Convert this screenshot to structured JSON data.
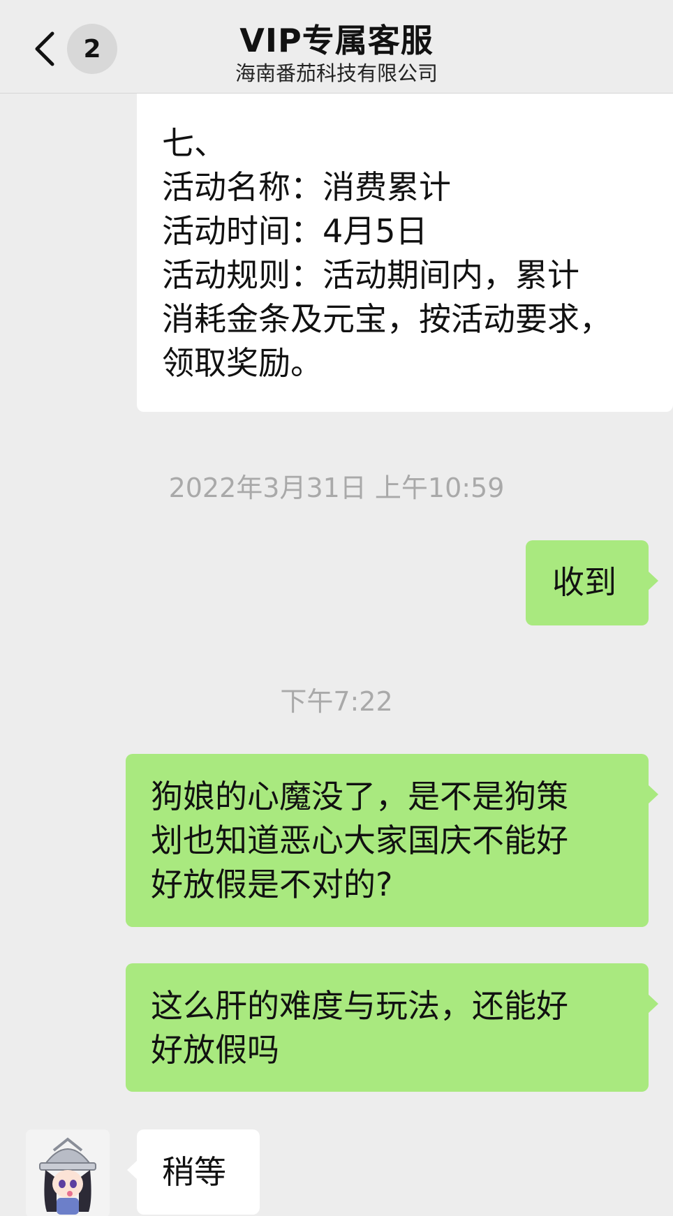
{
  "header": {
    "back_icon": "chevron-left-icon",
    "unread_count": "2",
    "title": "VIP专属客服",
    "subtitle": "海南番茄科技有限公司"
  },
  "messages": {
    "m1": {
      "line1": "七、",
      "line2": "活动名称：消费累计",
      "line3": "活动时间：4月5日",
      "line4": "活动规则：活动期间内，累计",
      "line5": "消耗金条及元宝，按活动要求，",
      "line6": "领取奖励。"
    },
    "ts1": "2022年3月31日 上午10:59",
    "m2": "收到",
    "ts2": "下午7:22",
    "m3": {
      "line1": "狗娘的心魔没了，是不是狗策",
      "line2": "划也知道恶心大家国庆不能好",
      "line3": "好放假是不对的?"
    },
    "m4": {
      "line1": "这么肝的难度与玩法，还能好",
      "line2": "好放假吗"
    },
    "m5": "稍等"
  },
  "colors": {
    "background": "#ededed",
    "sent_bubble": "#a9e97f",
    "received_bubble": "#ffffff",
    "timestamp": "#a9a9a9"
  }
}
